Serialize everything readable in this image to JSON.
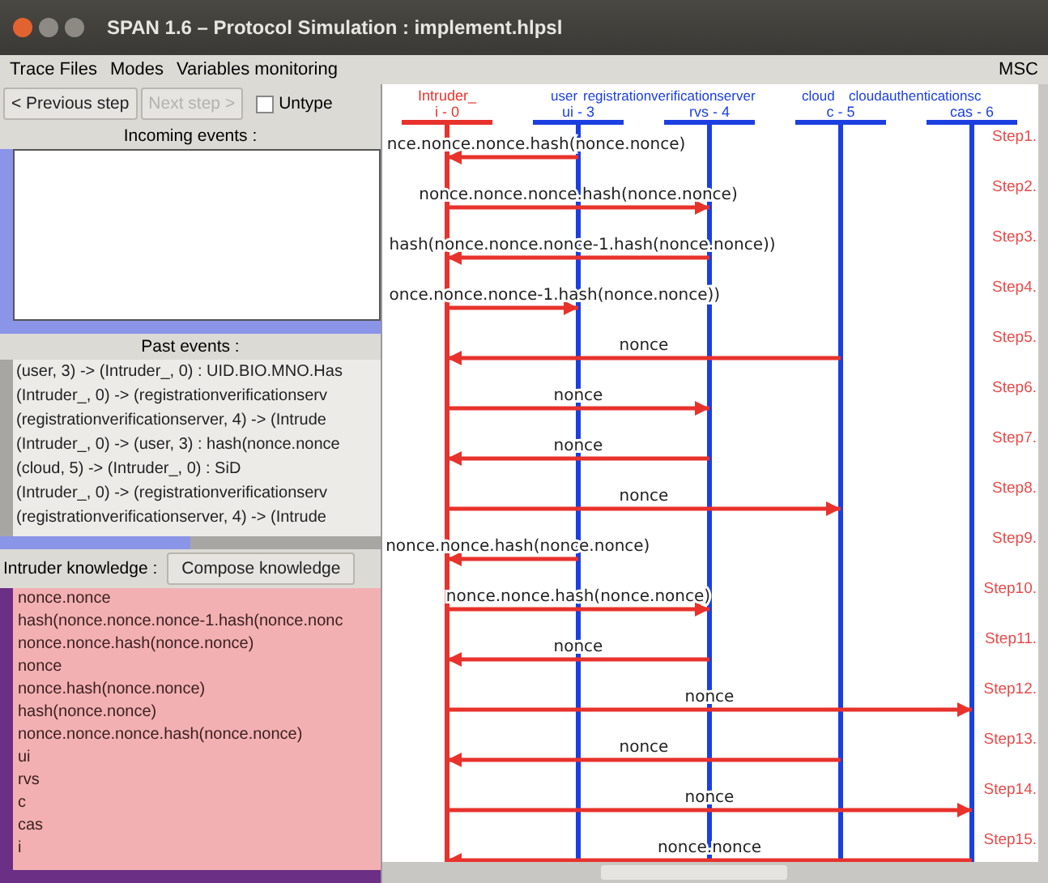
{
  "window": {
    "title": "SPAN 1.6 – Protocol Simulation : implement.hlpsl"
  },
  "menu": [
    {
      "label": "Trace Files"
    },
    {
      "label": "Modes"
    },
    {
      "label": "Variables monitoring"
    }
  ],
  "menu_right_label": "MSC",
  "controls": {
    "previous_button": {
      "label": "< Previous step",
      "disabled": false
    },
    "next_button": {
      "label": "Next step >",
      "disabled": true
    },
    "untype": {
      "label": "Untype",
      "checked": false
    }
  },
  "incoming_events": {
    "title": "Incoming events :"
  },
  "past_events": {
    "title": "Past events :",
    "items": [
      "(user, 3) -> (Intruder_, 0) : UID.BIO.MNO.Has",
      "(Intruder_, 0) -> (registrationverificationserv",
      "(registrationverificationserver, 4) -> (Intrude",
      "(Intruder_, 0) -> (user, 3) : hash(nonce.nonce",
      "(cloud, 5) -> (Intruder_, 0) : SiD",
      "(Intruder_, 0) -> (registrationverificationserv",
      "(registrationverificationserver, 4) -> (Intrude"
    ]
  },
  "intruder_knowledge": {
    "title": "Intruder knowledge :",
    "button": "Compose knowledge",
    "items": [
      "nonce.nonce",
      "hash(nonce.nonce.nonce-1.hash(nonce.nonc",
      "nonce.nonce.hash(nonce.nonce)",
      "nonce",
      "nonce.hash(nonce.nonce)",
      "hash(nonce.nonce)",
      "nonce.nonce.nonce.hash(nonce.nonce)",
      "ui",
      "rvs",
      "c",
      "cas",
      "i"
    ]
  },
  "msc": {
    "participants": [
      {
        "name": "Intruder_",
        "id_label": "i - 0",
        "color": "#e8322c"
      },
      {
        "name": "user",
        "id_label": "ui - 3",
        "color": "#1b3fe0"
      },
      {
        "name": "registrationverificationserver",
        "id_label": "rvs - 4",
        "color": "#1b3fe0"
      },
      {
        "name": "cloud",
        "id_label": "c - 5",
        "color": "#1b3fe0"
      },
      {
        "name": "cloudauthenticationsc",
        "id_label": "cas - 6",
        "color": "#1b3fe0"
      }
    ],
    "steps": [
      {
        "label": "Step1.",
        "message": "nce.nonce.nonce.hash(nonce.nonce)"
      },
      {
        "label": "Step2.",
        "message": "nonce.nonce.nonce.hash(nonce.nonce)"
      },
      {
        "label": "Step3.",
        "message": "hash(nonce.nonce.nonce-1.hash(nonce.nonce))"
      },
      {
        "label": "Step4.",
        "message": "once.nonce.nonce-1.hash(nonce.nonce))"
      },
      {
        "label": "Step5.",
        "message": "nonce"
      },
      {
        "label": "Step6.",
        "message": "nonce"
      },
      {
        "label": "Step7.",
        "message": "nonce"
      },
      {
        "label": "Step8.",
        "message": "nonce"
      },
      {
        "label": "Step9.",
        "message": "nonce.nonce.hash(nonce.nonce)"
      },
      {
        "label": "Step10.",
        "message": "nonce.nonce.hash(nonce.nonce)"
      },
      {
        "label": "Step11.",
        "message": "nonce"
      },
      {
        "label": "Step12.",
        "message": "nonce"
      },
      {
        "label": "Step13.",
        "message": "nonce"
      },
      {
        "label": "Step14.",
        "message": "nonce"
      },
      {
        "label": "Step15.",
        "message": "nonce.nonce"
      }
    ]
  }
}
